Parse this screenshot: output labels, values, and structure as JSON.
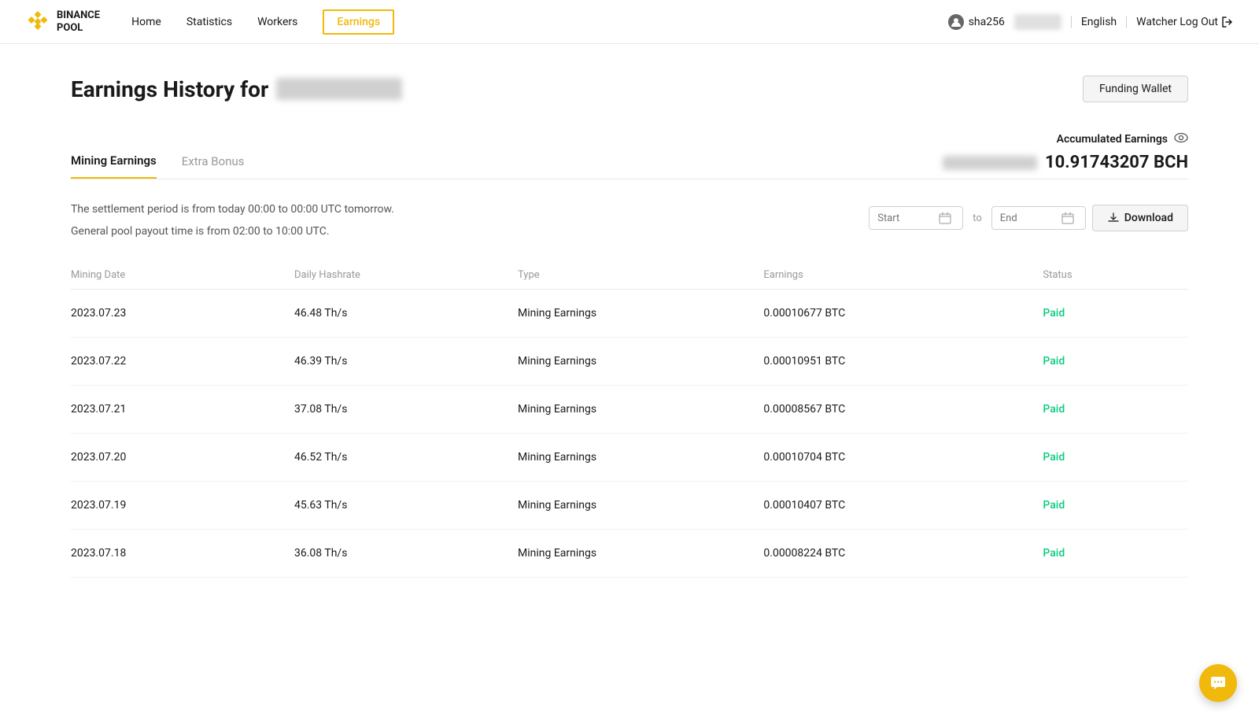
{
  "header": {
    "logo_line1": "BINANCE",
    "logo_line2": "POOL",
    "nav": [
      {
        "id": "home",
        "label": "Home",
        "active": false
      },
      {
        "id": "statistics",
        "label": "Statistics",
        "active": false
      },
      {
        "id": "workers",
        "label": "Workers",
        "active": false
      },
      {
        "id": "earnings",
        "label": "Earnings",
        "active": true
      }
    ],
    "account_id": "sha256",
    "language": "English",
    "watcher_logout": "Watcher Log Out"
  },
  "page": {
    "title_prefix": "Earnings History for",
    "funding_wallet_label": "Funding Wallet"
  },
  "tabs": [
    {
      "id": "mining",
      "label": "Mining Earnings",
      "active": true
    },
    {
      "id": "bonus",
      "label": "Extra Bonus",
      "active": false
    }
  ],
  "accumulated": {
    "label": "Accumulated Earnings",
    "value": "10.91743207 BCH"
  },
  "notices": [
    "The settlement period is from today 00:00 to 00:00 UTC tomorrow.",
    "General pool payout time is from 02:00 to 10:00 UTC."
  ],
  "date_filter": {
    "start_placeholder": "Start",
    "end_placeholder": "End",
    "to_label": "to",
    "download_label": "Download"
  },
  "table": {
    "columns": [
      {
        "id": "date",
        "label": "Mining Date"
      },
      {
        "id": "hashrate",
        "label": "Daily Hashrate"
      },
      {
        "id": "type",
        "label": "Type"
      },
      {
        "id": "earnings",
        "label": "Earnings"
      },
      {
        "id": "status",
        "label": "Status"
      }
    ],
    "rows": [
      {
        "date": "2023.07.23",
        "hashrate": "46.48 Th/s",
        "type": "Mining Earnings",
        "earnings": "0.00010677 BTC",
        "status": "Paid"
      },
      {
        "date": "2023.07.22",
        "hashrate": "46.39 Th/s",
        "type": "Mining Earnings",
        "earnings": "0.00010951 BTC",
        "status": "Paid"
      },
      {
        "date": "2023.07.21",
        "hashrate": "37.08 Th/s",
        "type": "Mining Earnings",
        "earnings": "0.00008567 BTC",
        "status": "Paid"
      },
      {
        "date": "2023.07.20",
        "hashrate": "46.52 Th/s",
        "type": "Mining Earnings",
        "earnings": "0.00010704 BTC",
        "status": "Paid"
      },
      {
        "date": "2023.07.19",
        "hashrate": "45.63 Th/s",
        "type": "Mining Earnings",
        "earnings": "0.00010407 BTC",
        "status": "Paid"
      },
      {
        "date": "2023.07.18",
        "hashrate": "36.08 Th/s",
        "type": "Mining Earnings",
        "earnings": "0.00008224 BTC",
        "status": "Paid"
      }
    ]
  }
}
